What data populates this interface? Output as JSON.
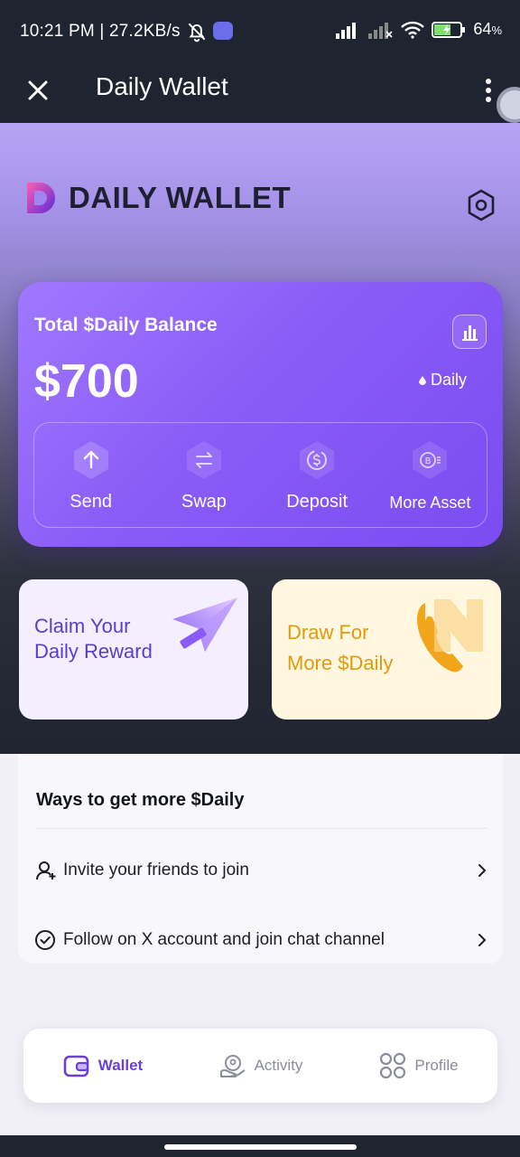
{
  "status_bar": {
    "time_speed": "10:21 PM | 27.2KB/s",
    "battery_percent": "64",
    "battery_suffix": "%",
    "icons": [
      "bell-off-icon",
      "discord-icon",
      "signal-icon",
      "signal-off-icon",
      "wifi-icon",
      "battery-icon"
    ]
  },
  "appbar": {
    "title": "Daily Wallet",
    "close_icon": "close-icon",
    "more_icon": "more-vertical-icon"
  },
  "brand": {
    "name": "DAILY WALLET",
    "settings_icon": "hexagon-settings-icon"
  },
  "balance": {
    "label": "Total $Daily Balance",
    "amount": "$700",
    "unit": "Daily",
    "stats_icon": "bar-chart-icon"
  },
  "actions": [
    {
      "label": "Send",
      "icon": "arrow-up-icon"
    },
    {
      "label": "Swap",
      "icon": "swap-icon"
    },
    {
      "label": "Deposit",
      "icon": "dollar-coin-icon"
    },
    {
      "label": "More Asset",
      "icon": "bitcoin-coin-icon"
    }
  ],
  "promos": {
    "claim": {
      "line1": "Claim Your",
      "line2": "Daily Reward"
    },
    "draw": {
      "line1": "Draw For",
      "line2": "More $Daily"
    }
  },
  "ways": {
    "title": "Ways to get more $Daily",
    "items": [
      {
        "label": "Invite your friends to join",
        "icon": "add-user-icon"
      },
      {
        "label": "Follow on X account and join chat channel",
        "icon": "check-circle-icon"
      }
    ]
  },
  "bottom_nav": [
    {
      "label": "Wallet",
      "icon": "wallet-icon",
      "active": true
    },
    {
      "label": "Activity",
      "icon": "activity-icon",
      "active": false
    },
    {
      "label": "Profile",
      "icon": "grid-icon",
      "active": false
    }
  ],
  "colors": {
    "accent": "#7b4cf0",
    "dark_bg": "#1e2530",
    "claim_text": "#5b3ec8",
    "draw_text": "#e29a0c"
  }
}
